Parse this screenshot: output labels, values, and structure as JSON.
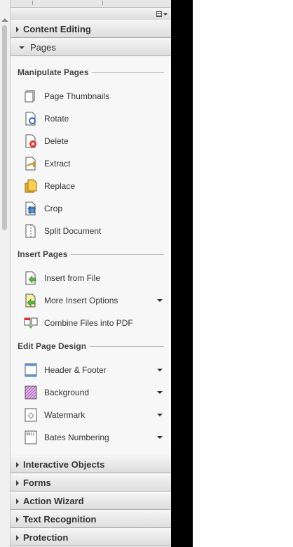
{
  "panel": {
    "sections_top": [
      {
        "label": "Content Editing",
        "expanded": false
      },
      {
        "label": "Pages",
        "expanded": true
      }
    ],
    "sections_bottom": [
      {
        "label": "Interactive Objects"
      },
      {
        "label": "Forms"
      },
      {
        "label": "Action Wizard"
      },
      {
        "label": "Text Recognition"
      },
      {
        "label": "Protection"
      }
    ]
  },
  "pages": {
    "groups": [
      {
        "heading": "Manipulate Pages",
        "tools": [
          {
            "label": "Page Thumbnails",
            "icon": "page-thumbnails-icon",
            "dropdown": false
          },
          {
            "label": "Rotate",
            "icon": "rotate-icon",
            "dropdown": false
          },
          {
            "label": "Delete",
            "icon": "delete-icon",
            "dropdown": false
          },
          {
            "label": "Extract",
            "icon": "extract-icon",
            "dropdown": false
          },
          {
            "label": "Replace",
            "icon": "replace-icon",
            "dropdown": false
          },
          {
            "label": "Crop",
            "icon": "crop-icon",
            "dropdown": false
          },
          {
            "label": "Split Document",
            "icon": "split-document-icon",
            "dropdown": false
          }
        ]
      },
      {
        "heading": "Insert Pages",
        "tools": [
          {
            "label": "Insert from File",
            "icon": "insert-from-file-icon",
            "dropdown": false
          },
          {
            "label": "More Insert Options",
            "icon": "more-insert-options-icon",
            "dropdown": true
          },
          {
            "label": "Combine Files into PDF",
            "icon": "combine-files-icon",
            "dropdown": false
          }
        ]
      },
      {
        "heading": "Edit Page Design",
        "tools": [
          {
            "label": "Header & Footer",
            "icon": "header-footer-icon",
            "dropdown": true
          },
          {
            "label": "Background",
            "icon": "background-icon",
            "dropdown": true
          },
          {
            "label": "Watermark",
            "icon": "watermark-icon",
            "dropdown": true
          },
          {
            "label": "Bates Numbering",
            "icon": "bates-numbering-icon",
            "dropdown": true
          }
        ]
      }
    ]
  },
  "colors": {
    "panel_bg": "#f2f2f2",
    "section_text": "#333333",
    "right_strip": "#000000"
  }
}
